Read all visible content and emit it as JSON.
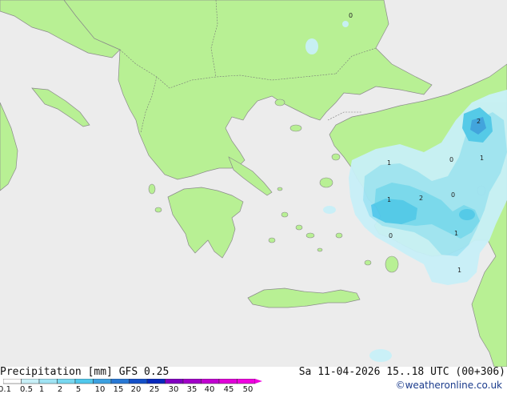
{
  "header": {
    "product_label": "Precipitation [mm]",
    "model": "GFS 0.25",
    "valid_time": "Sa 11-04-2026 15..18 UTC (00+306)"
  },
  "credit": "©weatheronline.co.uk",
  "legend": {
    "ticks": [
      "0.1",
      "0.5",
      "1",
      "2",
      "5",
      "10",
      "15",
      "20",
      "25",
      "30",
      "35",
      "40",
      "45",
      "50"
    ],
    "colors": [
      "#ffffff",
      "#c8f0f8",
      "#a0e4f4",
      "#78d8f0",
      "#50c8ec",
      "#3ca0e0",
      "#2878d4",
      "#1450c8",
      "#0828bc",
      "#8000c0",
      "#a000c8",
      "#c000d0",
      "#e000d8",
      "#f000e0"
    ]
  },
  "map": {
    "sea_color": "#ececec",
    "land_color": "#b8f094",
    "precip_labels": [
      "1",
      "2",
      "1",
      "0",
      "1",
      "2",
      "0",
      "1",
      "0",
      "1",
      "0"
    ]
  }
}
